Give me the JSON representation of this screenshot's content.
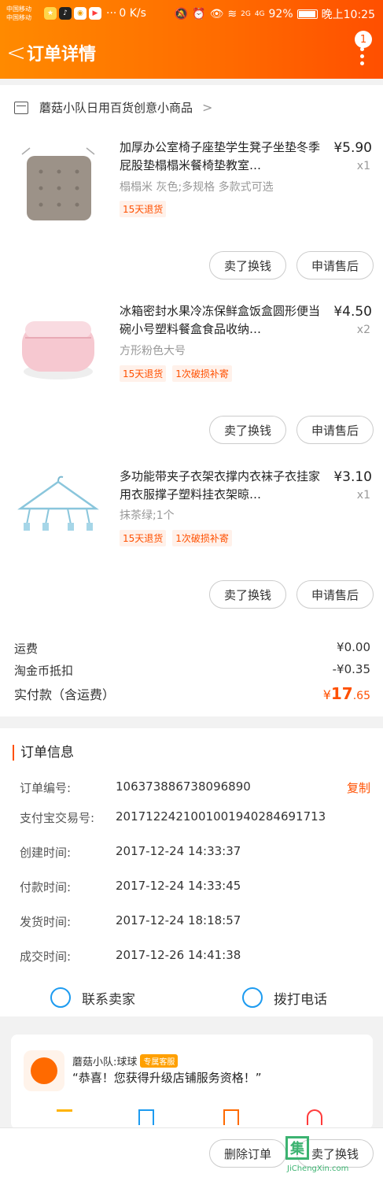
{
  "status_bar": {
    "carrier_1": "中国移动",
    "carrier_2": "中国移动",
    "speed": "0 K/s",
    "network_1": "2G",
    "network_2": "4G",
    "battery": "92%",
    "time": "晚上10:25"
  },
  "header": {
    "back_label": "<",
    "title": "订单详情",
    "notification_count": "1"
  },
  "shop": {
    "name": "蘑菇小队日用百货创意小商品",
    "chevron": ">"
  },
  "items": [
    {
      "name": "加厚办公室椅子座垫学生凳子坐垫冬季屁股垫榻榻米餐椅垫教室…",
      "spec": "榻榻米 灰色;多规格 多款式可选",
      "price": "¥5.90",
      "qty": "x1",
      "tags": [
        "15天退货"
      ],
      "btn_sell": "卖了换钱",
      "btn_after_sale": "申请售后"
    },
    {
      "name": "冰箱密封水果冷冻保鲜盒饭盒圆形便当碗小号塑料餐盒食品收纳…",
      "spec": "方形粉色大号",
      "price": "¥4.50",
      "qty": "x2",
      "tags": [
        "15天退货",
        "1次破损补寄"
      ],
      "btn_sell": "卖了换钱",
      "btn_after_sale": "申请售后"
    },
    {
      "name": "多功能带夹子衣架衣撑内衣袜子衣挂家用衣服撑子塑料挂衣架晾…",
      "spec": "抹茶绿;1个",
      "price": "¥3.10",
      "qty": "x1",
      "tags": [
        "15天退货",
        "1次破损补寄"
      ],
      "btn_sell": "卖了换钱",
      "btn_after_sale": "申请售后"
    }
  ],
  "fees": {
    "shipping_label": "运费",
    "shipping_value": "¥0.00",
    "coin_label": "淘金币抵扣",
    "coin_value": "-¥0.35",
    "total_label": "实付款（含运费）",
    "total_currency": "¥",
    "total_int": "17",
    "total_dec": ".65"
  },
  "order_info": {
    "title": "订单信息",
    "copy_label": "复制",
    "rows": [
      {
        "key": "订单编号:",
        "value": "106373886738096890"
      },
      {
        "key": "支付宝交易号:",
        "value": "2017122421001001940284691713"
      },
      {
        "key": "创建时间:",
        "value": "2017-12-24 14:33:37"
      },
      {
        "key": "付款时间:",
        "value": "2017-12-24 14:33:45"
      },
      {
        "key": "发货时间:",
        "value": "2017-12-24 18:18:57"
      },
      {
        "key": "成交时间:",
        "value": "2017-12-26 14:41:38"
      }
    ]
  },
  "contact": {
    "seller_label": "联系卖家",
    "phone_label": "拨打电话"
  },
  "service": {
    "name": "蘑菇小队:球球",
    "tag": "专属客服",
    "message": "“恭喜！您获得升级店铺服务资格！”"
  },
  "bottom_bar": {
    "delete_label": "删除订单",
    "sell_label": "卖了换钱"
  },
  "watermark": {
    "char": "集",
    "site": "JiChengXin.com"
  },
  "colors": {
    "accent": "#ff5000",
    "header_start": "#ff8a00",
    "header_end": "#ff4f00",
    "link_blue": "#1d9bf0"
  }
}
